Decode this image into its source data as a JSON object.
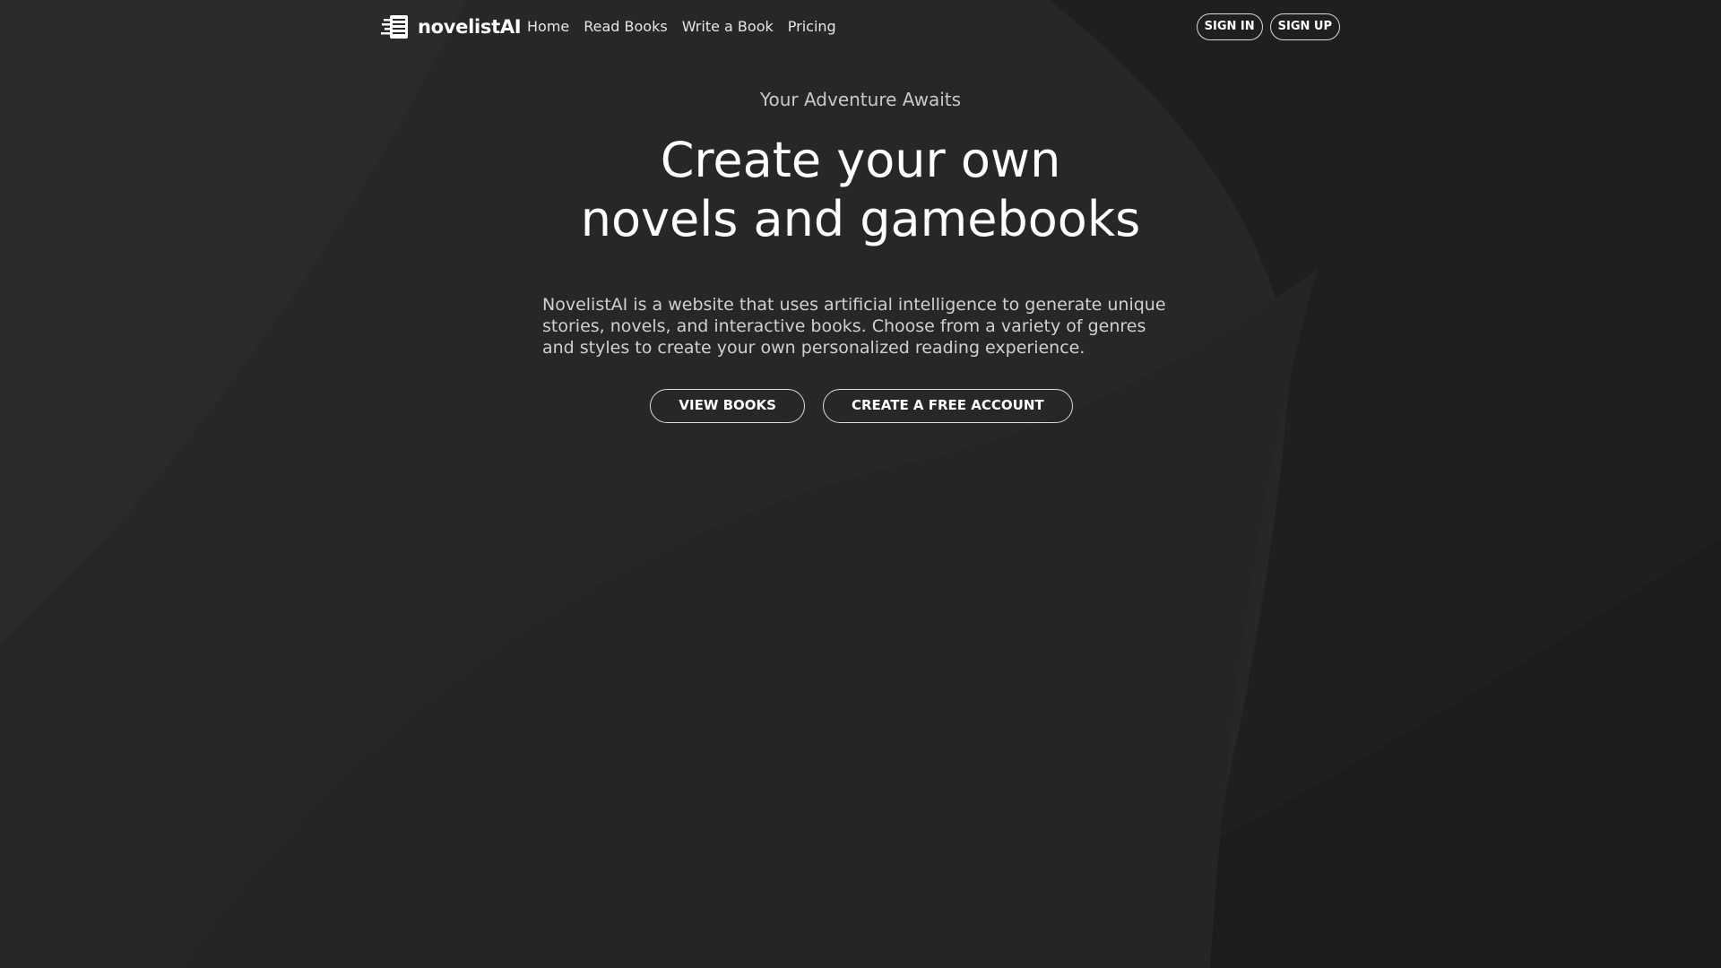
{
  "brand": {
    "name": "novelistAI",
    "logo_icon": "book-pages-icon"
  },
  "nav": {
    "links": [
      {
        "label": "Home"
      },
      {
        "label": "Read Books"
      },
      {
        "label": "Write a Book"
      },
      {
        "label": "Pricing"
      }
    ],
    "sign_in_label": "SIGN IN",
    "sign_up_label": "SIGN UP"
  },
  "hero": {
    "tagline": "Your Adventure Awaits",
    "headline_line1": "Create your own",
    "headline_line2": "novels and gamebooks",
    "description": "NovelistAI is a website that uses artificial intelligence to generate unique stories, novels, and interactive books. Choose from a variety of genres and styles to create your own personalized reading experience.",
    "view_books_label": "VIEW BOOKS",
    "create_account_label": "CREATE A FREE ACCOUNT"
  },
  "colors": {
    "background": "#272727",
    "text": "#ffffff",
    "muted_text": "#c9c9c9",
    "button_border": "#d9d9d9"
  }
}
